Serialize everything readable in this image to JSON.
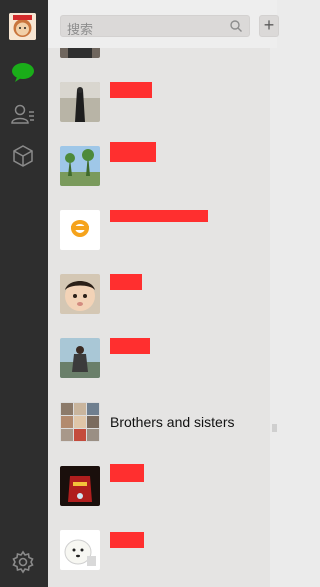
{
  "search": {
    "placeholder": "搜索"
  },
  "toolbar": {
    "add_label": "+"
  },
  "chats": [
    {
      "name": "Brothers and sisters"
    }
  ],
  "colors": {
    "sidebar": "#2e2e2e",
    "accent_green": "#1aad19",
    "list_bg": "#e5e4e3",
    "redaction": "#ff2f2f"
  }
}
